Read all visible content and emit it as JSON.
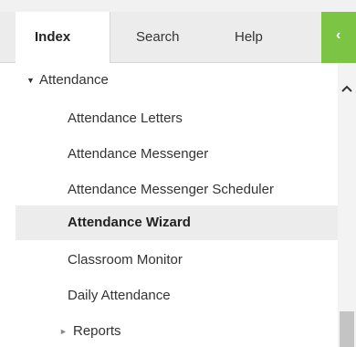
{
  "tabs": [
    {
      "label": "Index"
    },
    {
      "label": "Search"
    },
    {
      "label": "Help"
    }
  ],
  "collapse_icon": "chevron-left-icon",
  "collapse_glyph": "‹",
  "tree": {
    "parent": {
      "label": "Attendance",
      "expanded_glyph": "▼"
    },
    "items": [
      {
        "label": "Attendance Letters"
      },
      {
        "label": "Attendance Messenger"
      },
      {
        "label": "Attendance Messenger Scheduler"
      },
      {
        "label": "Attendance Wizard",
        "selected": true
      },
      {
        "label": "Classroom Monitor"
      },
      {
        "label": "Daily Attendance"
      }
    ],
    "subfolder": {
      "label": "Reports",
      "collapsed_glyph": "►"
    }
  },
  "colors": {
    "accent": "#7cc443",
    "selected_bg": "#ececec",
    "tab_bar_bg": "#ececec"
  }
}
